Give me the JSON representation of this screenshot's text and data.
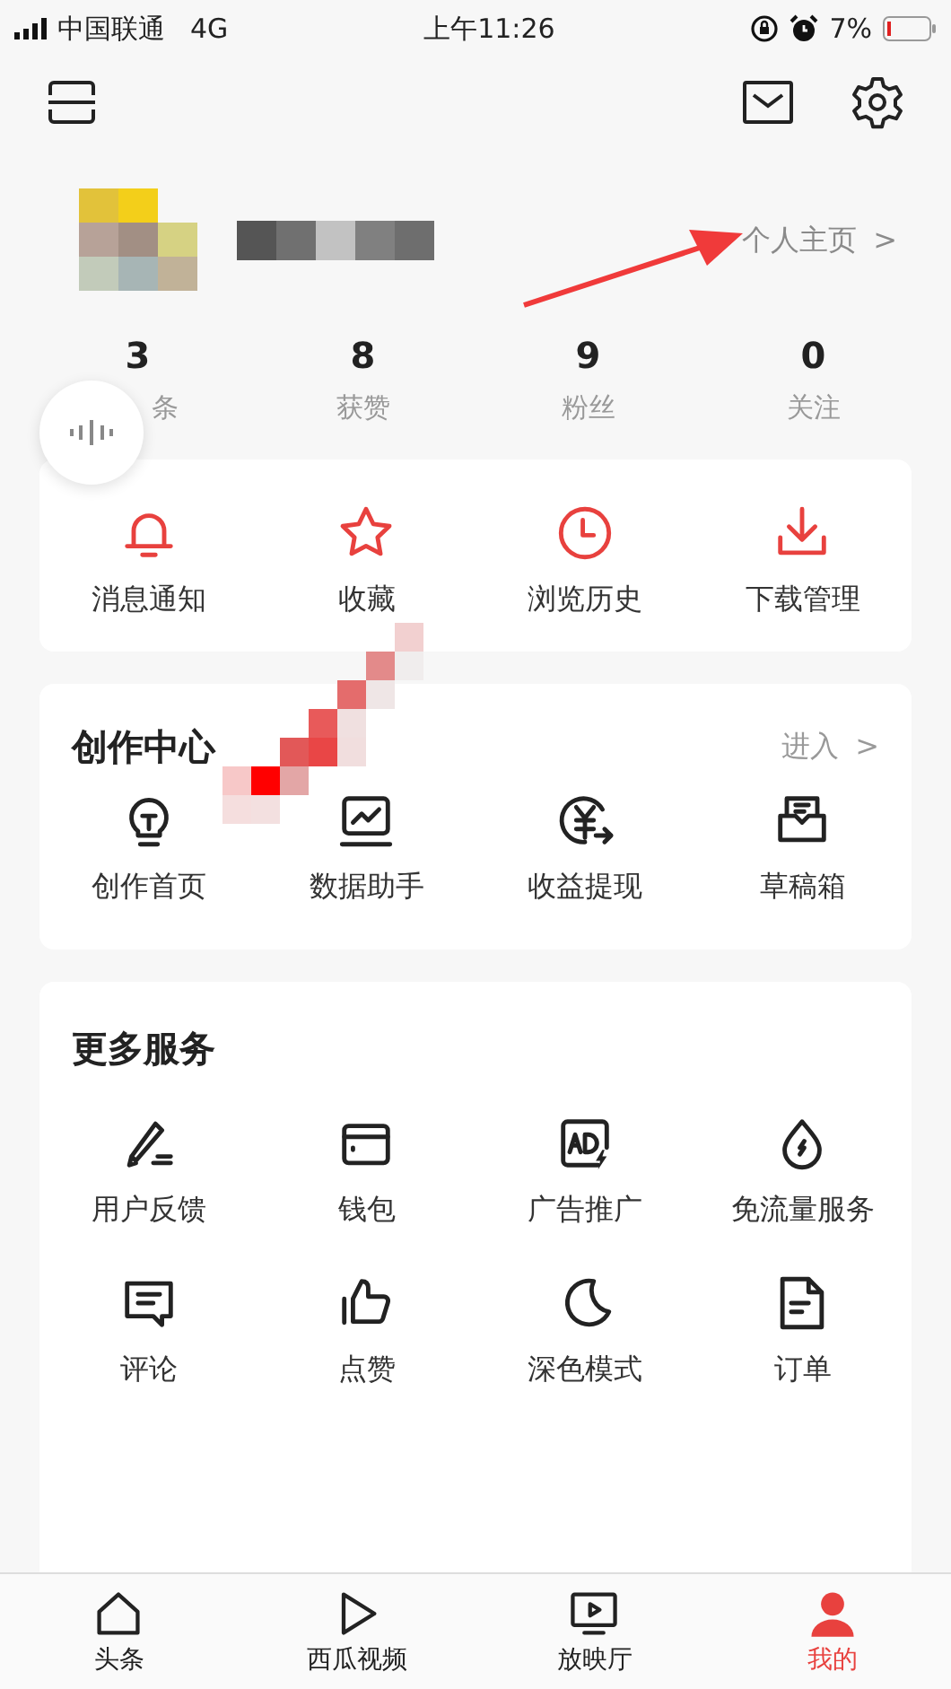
{
  "status_bar": {
    "carrier": "中国联通",
    "network": "4G",
    "time": "上午11:26",
    "battery": "7%"
  },
  "profile": {
    "link": "个人主页",
    "chevron": ">"
  },
  "stats": [
    {
      "value": "3",
      "label": "条"
    },
    {
      "value": "8",
      "label": "获赞"
    },
    {
      "value": "9",
      "label": "粉丝"
    },
    {
      "value": "0",
      "label": "关注"
    }
  ],
  "quick_actions": [
    "消息通知",
    "收藏",
    "浏览历史",
    "下载管理"
  ],
  "creation_center": {
    "title": "创作中心",
    "link": "进入",
    "chevron": ">",
    "items": [
      "创作首页",
      "数据助手",
      "收益提现",
      "草稿箱"
    ]
  },
  "more_services": {
    "title": "更多服务",
    "items": [
      "用户反馈",
      "钱包",
      "广告推广",
      "免流量服务",
      "评论",
      "点赞",
      "深色模式",
      "订单"
    ]
  },
  "tab_bar": [
    {
      "label": "头条",
      "selected": false
    },
    {
      "label": "西瓜视频",
      "selected": false
    },
    {
      "label": "放映厅",
      "selected": false
    },
    {
      "label": "我的",
      "selected": true
    }
  ]
}
